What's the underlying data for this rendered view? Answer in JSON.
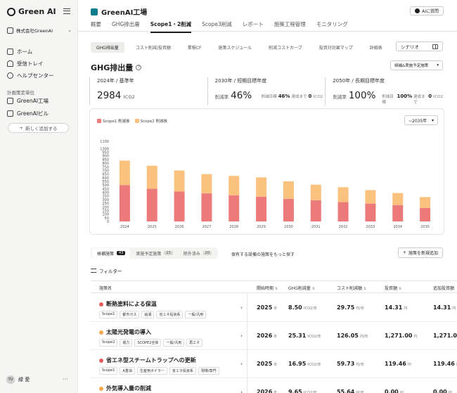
{
  "app": {
    "name": "Green AI"
  },
  "sidebar": {
    "org": "株式会社GreenAI",
    "nav": [
      {
        "label": "ホーム",
        "icon": "home-icon"
      },
      {
        "label": "受信トレイ",
        "icon": "bell-icon"
      },
      {
        "label": "ヘルプセンター",
        "icon": "help-icon"
      }
    ],
    "section_label": "計画策定単位",
    "units": [
      {
        "label": "GreenAI工場",
        "icon": "factory-icon"
      },
      {
        "label": "GreenAIビル",
        "icon": "building-icon"
      }
    ],
    "add_label": "新しく追加する",
    "user": {
      "initials": "TU",
      "name": "緑 愛"
    }
  },
  "header": {
    "title": "GreenAI工場",
    "ai_button": "AIに質問",
    "tabs": [
      "概要",
      "GHG排出量",
      "Scope1・2削減",
      "Scope3削減",
      "レポート",
      "施策工程管理",
      "モニタリング"
    ],
    "active_tab": 2
  },
  "subtabs": {
    "items": [
      "GHG排出量",
      "コスト削減/投資額",
      "累積CF",
      "施策スケジュール",
      "削減コストカーブ",
      "投資対効果マップ",
      "詳細表"
    ],
    "active": 0,
    "scenario_label": "シナリオ"
  },
  "ghg": {
    "title": "GHG排出量",
    "filter": "候補&実施予定施策",
    "stats": [
      {
        "label": "2024年 / 基準年",
        "value": "2984",
        "unit": "tCO2"
      },
      {
        "label": "2030年 / 短期目標年度",
        "prefix": "削減率",
        "value": "46%",
        "sub_label": "削減目標",
        "sub_value": "46%",
        "sub_mid": "達成まで",
        "sub_rest": "0",
        "sub_unit": "tCO2"
      },
      {
        "label": "2050年 / 長期目標年度",
        "prefix": "削減率",
        "value": "100%",
        "sub_label": "削減目標",
        "sub_value": "100%",
        "sub_mid": "達成まで",
        "sub_rest": "0",
        "sub_unit": "tCO2"
      }
    ]
  },
  "chart_data": {
    "type": "bar",
    "stacked": true,
    "categories": [
      "2024",
      "2025",
      "2026",
      "2027",
      "2028",
      "2029",
      "2030",
      "2031",
      "2032",
      "2033",
      "2034",
      "2035"
    ],
    "series": [
      {
        "name": "Scope1 削減後",
        "color": "#ec7a7a",
        "values": [
          500,
          450,
          410,
          385,
          360,
          340,
          310,
          290,
          265,
          245,
          225,
          185
        ]
      },
      {
        "name": "Scope2 削減後",
        "color": "#fbc27f",
        "values": [
          335,
          315,
          290,
          265,
          265,
          265,
          240,
          215,
          205,
          185,
          165,
          150
        ]
      }
    ],
    "ylim": [
      0,
      1100
    ],
    "yticks": [
      0,
      50,
      100,
      150,
      200,
      250,
      300,
      350,
      400,
      450,
      500,
      550,
      600,
      650,
      700,
      750,
      800,
      850,
      900,
      950,
      1000,
      1100
    ],
    "range_select": "~2035年",
    "grid": false,
    "legend": "top-left"
  },
  "proposals": {
    "tabs": [
      {
        "label": "候補施策",
        "count": "43"
      },
      {
        "label": "実施予定施策",
        "count": "23"
      },
      {
        "label": "除外済み",
        "count": "20"
      }
    ],
    "more_link": "保有する設備の施策をもっと探す",
    "new_button": "施策を新規追加",
    "filter_label": "フィルター",
    "columns": [
      "施策名",
      "開始時期",
      "GHG削減量",
      "コスト削減額",
      "投資額",
      "追加投資額"
    ],
    "rows": [
      {
        "name": "断熱塗料による保温",
        "dot": "#e35d5d",
        "tags": [
          "Scope1",
          "都市ガス",
          "給湯",
          "省エネ投資系",
          "一般/汎用"
        ],
        "start": "2025",
        "start_unit": "年",
        "ghg": "8.50",
        "ghg_unit": "tCO2/年",
        "cost": "29.75",
        "cost_unit": "円/年",
        "inv": "14.31",
        "inv_unit": "円",
        "add": "14.31",
        "add_unit": "円"
      },
      {
        "name": "太陽光発電の導入",
        "dot": "#f6a94a",
        "tags": [
          "Scope2",
          "電力",
          "SCOPE2全体",
          "一般/汎用",
          "再エネ"
        ],
        "start": "2026",
        "start_unit": "年",
        "ghg": "25.31",
        "ghg_unit": "tCO2/年",
        "cost": "126.05",
        "cost_unit": "円/年",
        "inv": "1,271.00",
        "inv_unit": "円",
        "add": "1,271.00",
        "add_unit": "円"
      },
      {
        "name": "省エネ型スチームトラップへの更新",
        "dot": "#e35d5d",
        "tags": [
          "Scope1",
          "A重油",
          "生産用ボイラー",
          "省エネ投資系",
          "現場/専門"
        ],
        "start": "2025",
        "start_unit": "年",
        "ghg": "16.95",
        "ghg_unit": "tCO2/年",
        "cost": "59.73",
        "cost_unit": "円/年",
        "inv": "119.46",
        "inv_unit": "円",
        "add": "119.46",
        "add_unit": "円"
      },
      {
        "name": "外気導入量の削減",
        "dot": "#f6a94a",
        "tags": [],
        "start": "2026",
        "start_unit": "年",
        "ghg": "9.65",
        "ghg_unit": "tCO2/年",
        "cost": "55.64",
        "cost_unit": "円/年",
        "inv": "0.00",
        "inv_unit": "円",
        "add": "0.00",
        "add_unit": "円"
      }
    ]
  }
}
